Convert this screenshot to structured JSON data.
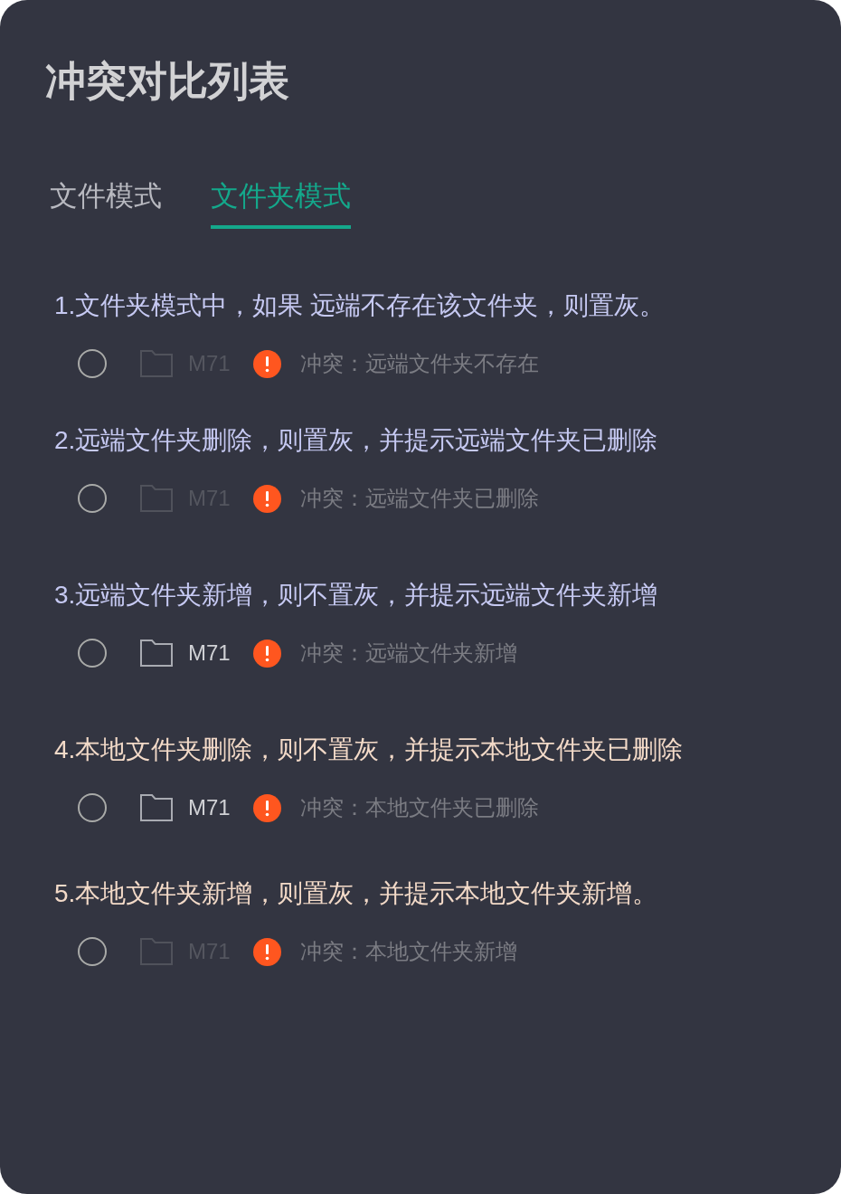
{
  "panel": {
    "title": "冲突对比列表"
  },
  "tabs": [
    {
      "label": "文件模式",
      "selected": false
    },
    {
      "label": "文件夹模式",
      "selected": true
    }
  ],
  "rules": [
    {
      "text": "1.文件夹模式中，如果 远端不存在该文件夹，则置灰。",
      "color": "#c6c9f2",
      "entry": {
        "selected": false,
        "disabled": true,
        "name": "M71",
        "conflict": "冲突：远端文件夹不存在"
      }
    },
    {
      "text": "2.远端文件夹删除，则置灰，并提示远端文件夹已删除",
      "color": "#c6c9f2",
      "entry": {
        "selected": false,
        "disabled": true,
        "name": "M71",
        "conflict": "冲突：远端文件夹已删除"
      }
    },
    {
      "text": "3.远端文件夹新增，则不置灰，并提示远端文件夹新增",
      "color": "#c6c9f2",
      "entry": {
        "selected": false,
        "disabled": false,
        "name": "M71",
        "conflict": "冲突：远端文件夹新增"
      }
    },
    {
      "text": "4.本地文件夹删除，则不置灰，并提示本地文件夹已删除",
      "color": "#f3dac8",
      "entry": {
        "selected": false,
        "disabled": false,
        "name": "M71",
        "conflict": "冲突：本地文件夹已删除"
      }
    },
    {
      "text": "5.本地文件夹新增，则置灰，并提示本地文件夹新增。",
      "color": "#f3dac8",
      "entry": {
        "selected": false,
        "disabled": true,
        "name": "M71",
        "conflict": "冲突：本地文件夹新增"
      }
    }
  ]
}
